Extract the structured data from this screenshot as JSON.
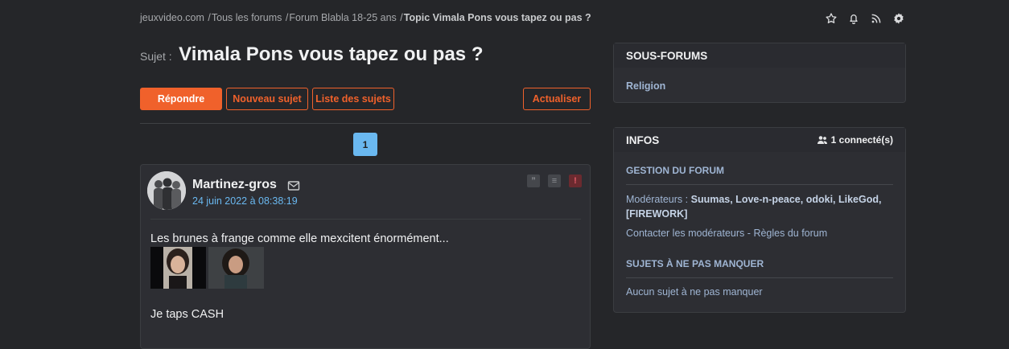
{
  "breadcrumb": {
    "items": [
      "jeuxvideo.com",
      "Tous les forums",
      "Forum Blabla 18-25 ans"
    ],
    "current": "Topic Vimala Pons vous tapez ou pas ?",
    "separator": "/"
  },
  "top_icons": [
    "star-icon",
    "bell-icon",
    "rss-icon",
    "gear-icon"
  ],
  "topic": {
    "prefix": "Sujet :",
    "title": "Vimala Pons vous tapez ou pas ?"
  },
  "buttons": {
    "reply": "Répondre",
    "new_topic": "Nouveau sujet",
    "topic_list": "Liste des sujets",
    "refresh": "Actualiser"
  },
  "pagination": {
    "current": "1"
  },
  "post": {
    "author": "Martinez-gros",
    "date": "24 juin 2022 à 08:38:19",
    "text": "Les brunes à frange comme elle mexcitent énormément...",
    "text2": "Je taps CASH",
    "actions": [
      "quote-icon",
      "sticker-icon",
      "report-icon"
    ],
    "action_symbols": {
      "quote": "”",
      "mood": "≡",
      "alert": "!"
    }
  },
  "subforums": {
    "title": "SOUS-FORUMS",
    "items": [
      "Religion"
    ]
  },
  "infos": {
    "title": "INFOS",
    "connected": "1 connecté(s)",
    "management_title": "GESTION DU FORUM",
    "moderators_label": "Modérateurs :",
    "moderators_line1": "Suumas, Love-n-peace, odoki, LikeGod,",
    "moderators_line2": "[FIREWORK]",
    "contact": "Contacter les modérateurs",
    "contact_sep": "-",
    "rules": "Règles du forum",
    "must_see_title": "SUJETS À NE PAS MANQUER",
    "must_see_empty": "Aucun sujet à ne pas manquer"
  },
  "colors": {
    "background": "#252629",
    "accent": "#f0612b",
    "link": "#6ab8f0",
    "sidebar_link": "#9fb5d3"
  }
}
